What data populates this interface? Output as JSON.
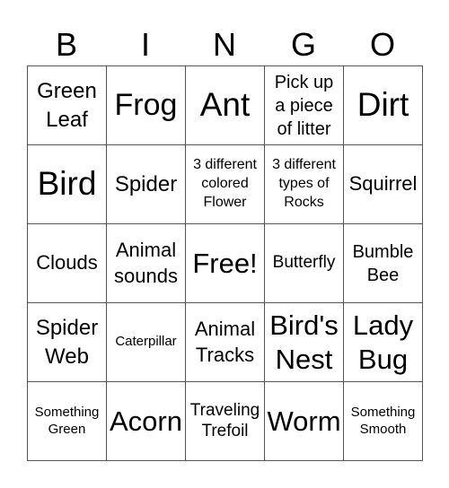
{
  "header": [
    "B",
    "I",
    "N",
    "G",
    "O"
  ],
  "cells": [
    [
      "Green\nLeaf",
      "Frog",
      "Ant",
      "Pick up\na piece\nof litter",
      "Dirt"
    ],
    [
      "Bird",
      "Spider",
      "3 different\ncolored\nFlower",
      "3 different\ntypes of\nRocks",
      "Squirrel"
    ],
    [
      "Clouds",
      "Animal\nsounds",
      "Free!",
      "Butterfly",
      "Bumble\nBee"
    ],
    [
      "Spider\nWeb",
      "Caterpillar",
      "Animal\nTracks",
      "Bird's\nNest",
      "Lady\nBug"
    ],
    [
      "Something\nGreen",
      "Acorn",
      "Traveling\nTrefoil",
      "Worm",
      "Something\nSmooth"
    ]
  ]
}
